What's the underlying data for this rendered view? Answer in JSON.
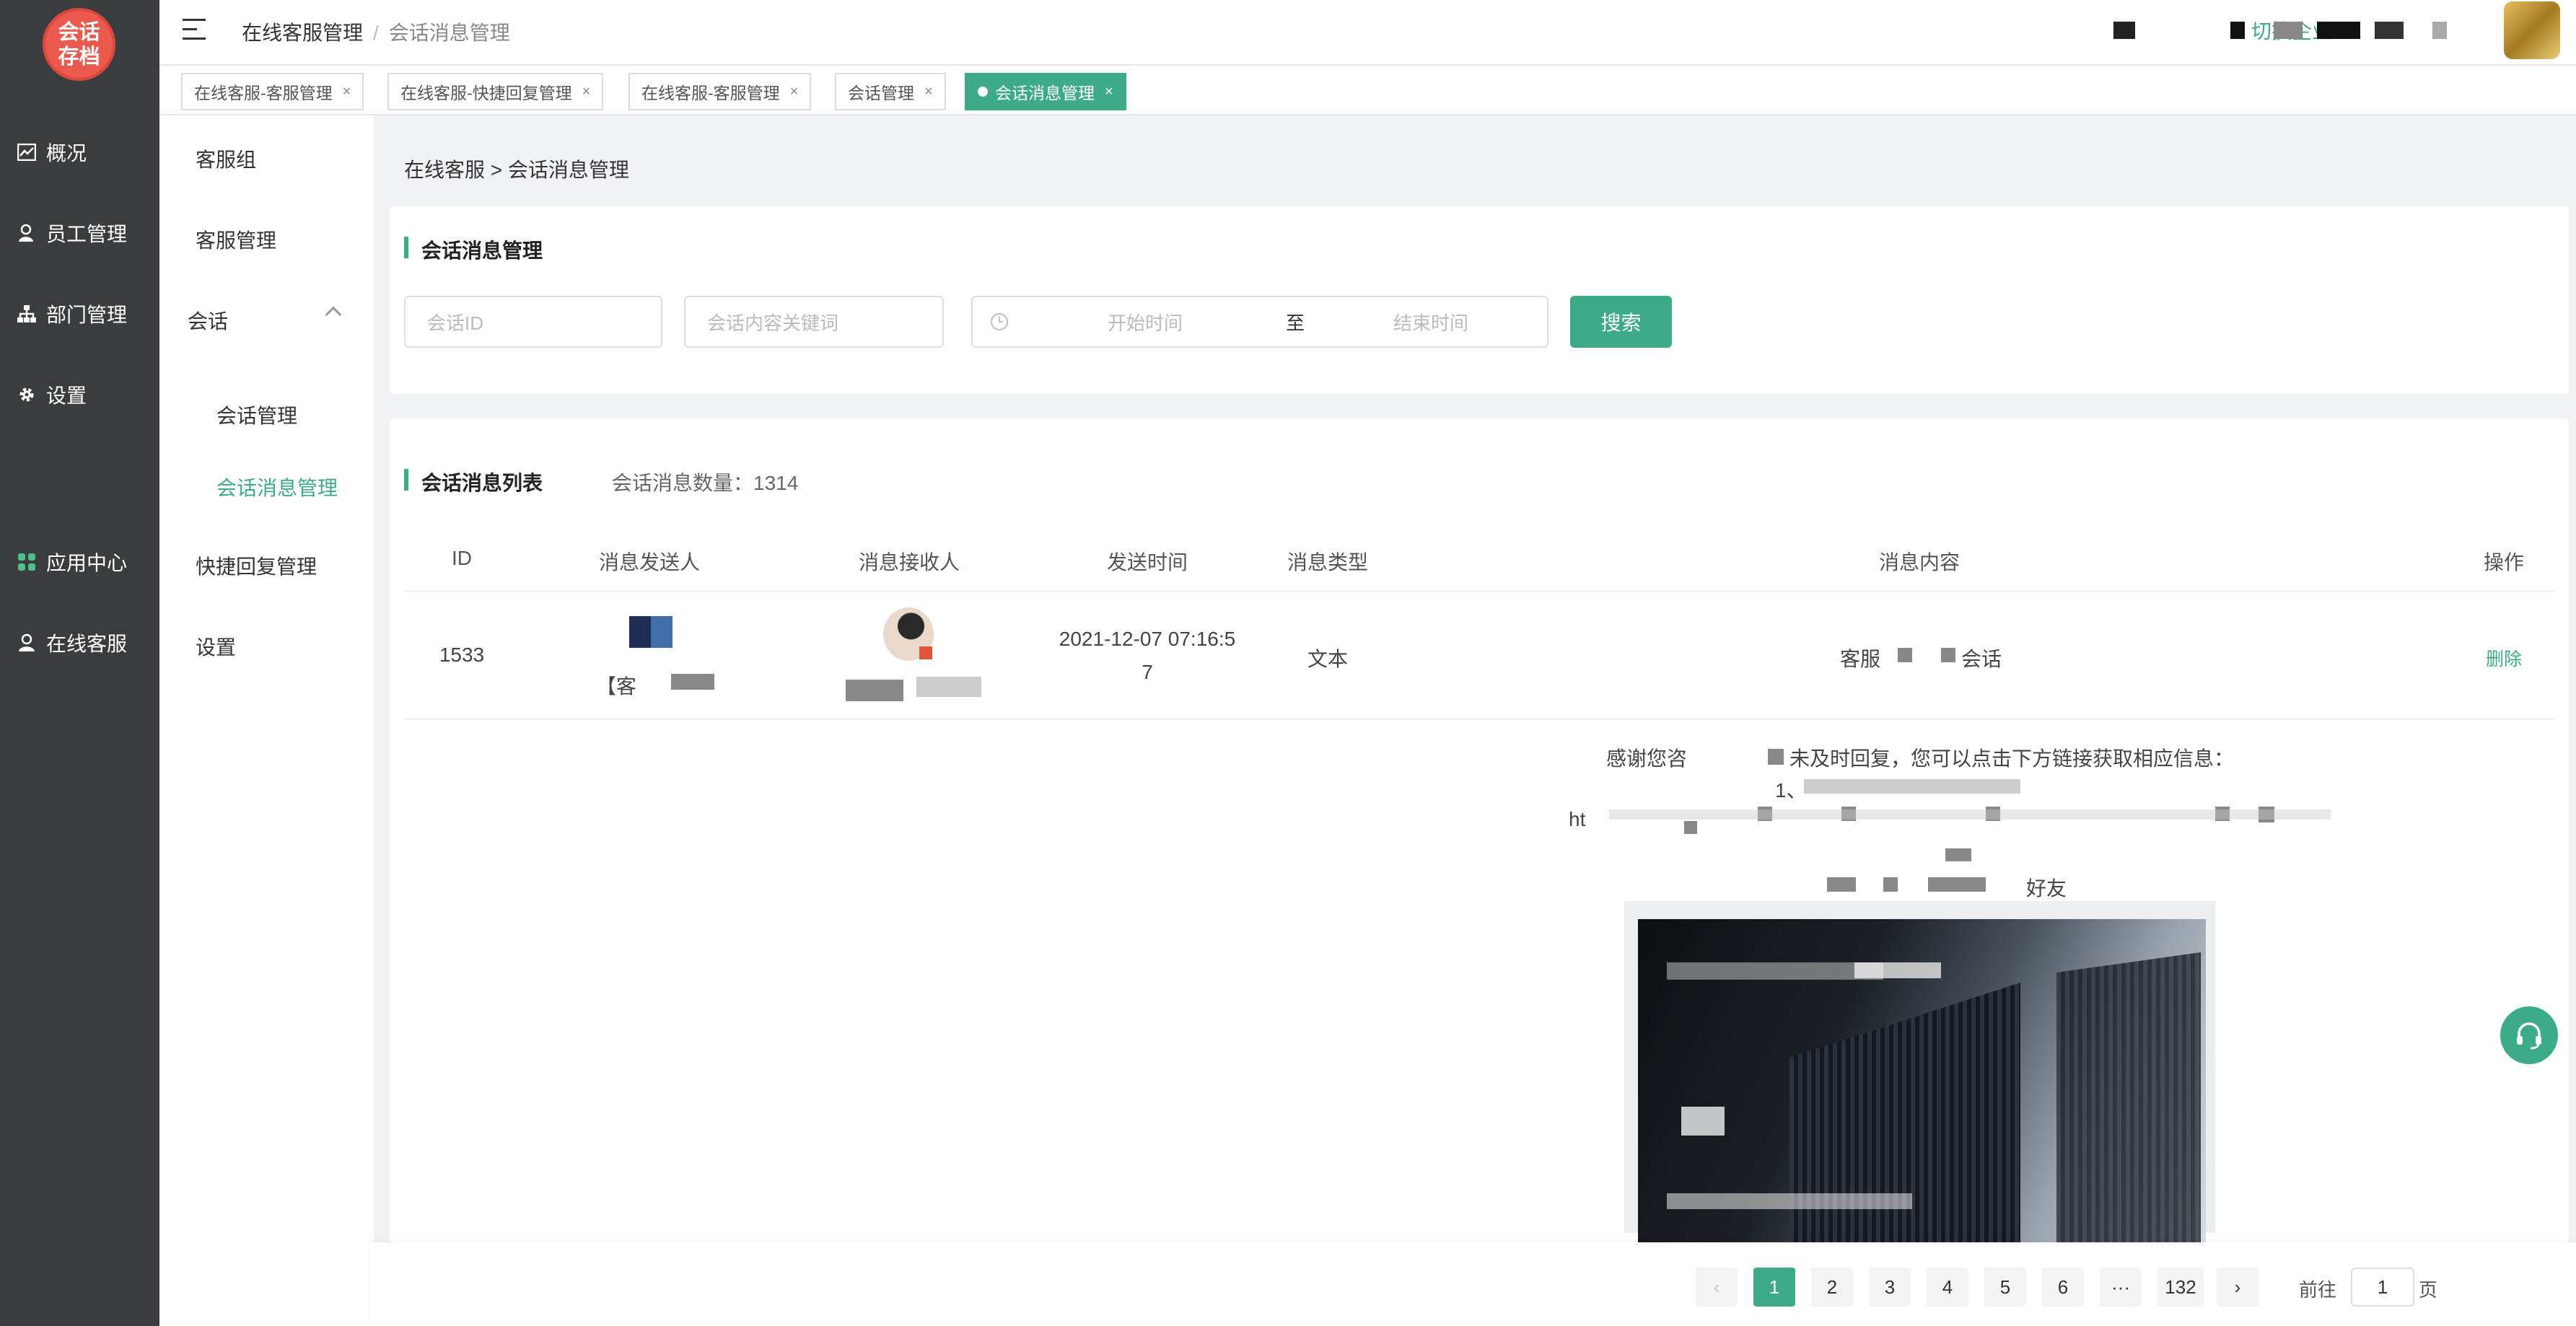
{
  "brand": {
    "line1": "会话",
    "line2": "存档"
  },
  "main_nav": [
    {
      "label": "概况",
      "icon": "chart-icon"
    },
    {
      "label": "员工管理",
      "icon": "user-icon"
    },
    {
      "label": "部门管理",
      "icon": "org-icon"
    },
    {
      "label": "设置",
      "icon": "gear-icon"
    },
    {
      "label": "应用中心",
      "icon": "apps-icon"
    },
    {
      "label": "在线客服",
      "icon": "user-icon"
    }
  ],
  "header": {
    "crumb_root": "在线客服管理",
    "crumb_sep": "/",
    "crumb_current": "会话消息管理",
    "switch_label": "切换企业"
  },
  "tabs": [
    {
      "label": "在线客服-客服管理",
      "close": "×"
    },
    {
      "label": "在线客服-快捷回复管理",
      "close": "×"
    },
    {
      "label": "在线客服-客服管理",
      "close": "×"
    },
    {
      "label": "会话管理",
      "close": "×"
    },
    {
      "label": "会话消息管理",
      "close": "×",
      "active": true
    }
  ],
  "subnav": {
    "group": "客服组",
    "agents": "客服管理",
    "session": "会话",
    "session_manage": "会话管理",
    "session_messages": "会话消息管理",
    "quick_reply": "快捷回复管理",
    "settings": "设置"
  },
  "page": {
    "crumb": "在线客服 > 会话消息管理",
    "filter_title": "会话消息管理",
    "session_id_placeholder": "会话ID",
    "keyword_placeholder": "会话内容关键词",
    "start_placeholder": "开始时间",
    "range_sep": "至",
    "end_placeholder": "结束时间",
    "search_label": "搜索",
    "list_title": "会话消息列表",
    "count_label": "会话消息数量：",
    "count_value": "1314"
  },
  "table": {
    "columns": [
      "ID",
      "消息发送人",
      "消息接收人",
      "发送时间",
      "消息类型",
      "消息内容",
      "操作"
    ],
    "row": {
      "id": "1533",
      "sender": "【客",
      "time_line1": "2021-12-07 07:16:5",
      "time_line2": "7",
      "type": "文本",
      "content_pre": "客服",
      "content_post": "会话",
      "action": "删除"
    },
    "message": {
      "line1_a": "感谢您咨",
      "line1_b": "未及时回复，您可以点击下方链接获取相应信息：",
      "line2": "1、",
      "line3": "ht",
      "line4": "好友"
    }
  },
  "pagination": {
    "prev": "‹",
    "pages": [
      "1",
      "2",
      "3",
      "4",
      "5",
      "6",
      "···",
      "132"
    ],
    "active_page": "1",
    "next": "›",
    "goto_label": "前往",
    "goto_value": "1",
    "goto_suffix": "页"
  },
  "colors": {
    "accent": "#3daa8a",
    "sidebar": "#3a3c40",
    "logo": "#ea5a4f"
  }
}
